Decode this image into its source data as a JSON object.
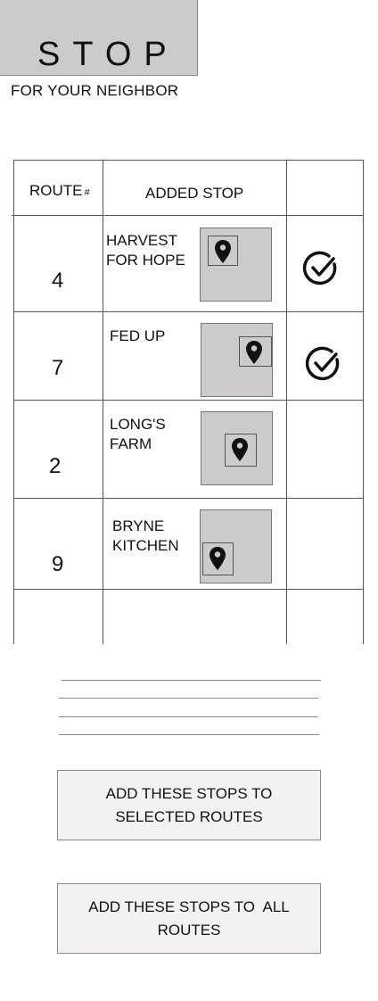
{
  "header": {
    "logo_text": "STOP",
    "tagline": "FOR YOUR NEIGHBOR"
  },
  "table": {
    "headers": {
      "route": "ROUTE",
      "route_symbol": "#",
      "added_stop": "ADDED STOP"
    },
    "rows": [
      {
        "route": "4",
        "stop_line1": "HARVEST",
        "stop_line2": "FOR HOPE",
        "selected": true,
        "icon": "map-pin-icon"
      },
      {
        "route": "7",
        "stop_line1": "FED UP",
        "stop_line2": "",
        "selected": true,
        "icon": "map-pin-icon"
      },
      {
        "route": "2",
        "stop_line1": "LONG'S",
        "stop_line2": "FARM",
        "selected": false,
        "icon": "map-pin-icon"
      },
      {
        "route": "9",
        "stop_line1": "BRYNE",
        "stop_line2": "KITCHEN",
        "selected": false,
        "icon": "map-pin-icon"
      }
    ]
  },
  "buttons": {
    "add_selected_line1": "ADD THESE STOPS TO",
    "add_selected_line2": "SELECTED ROUTES",
    "add_all_line1": "ADD THESE STOPS TO  ALL",
    "add_all_line2": "ROUTES"
  },
  "colors": {
    "placeholder_gray": "#cdcaca",
    "button_bg": "#f3f2f1",
    "border": "#555555"
  }
}
